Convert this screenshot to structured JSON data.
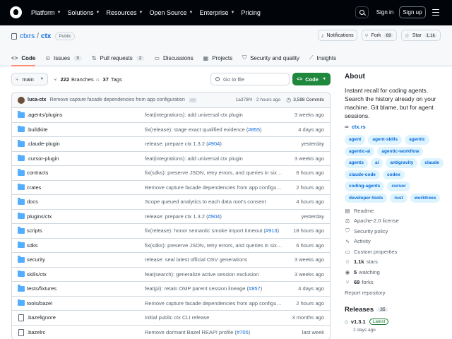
{
  "header": {
    "nav": [
      "Platform",
      "Solutions",
      "Resources",
      "Open Source",
      "Enterprise",
      "Pricing"
    ],
    "nav_has_chevron": [
      true,
      true,
      true,
      true,
      true,
      false
    ],
    "signin": "Sign in",
    "signup": "Sign up"
  },
  "repo": {
    "owner": "ctxrs",
    "sep": "/",
    "name": "ctx",
    "visibility": "Public",
    "notifications": "Notifications",
    "fork_label": "Fork",
    "fork_count": "69",
    "star_label": "Star",
    "star_count": "1.1k"
  },
  "tabs": [
    {
      "label": "Code",
      "icon": "<>",
      "count": ""
    },
    {
      "label": "Issues",
      "icon": "⊙",
      "count": "3"
    },
    {
      "label": "Pull requests",
      "icon": "⇅",
      "count": "2"
    },
    {
      "label": "Discussions",
      "icon": "▭",
      "count": ""
    },
    {
      "label": "Projects",
      "icon": "▦",
      "count": ""
    },
    {
      "label": "Security and quality",
      "icon": "⛉",
      "count": ""
    },
    {
      "label": "Insights",
      "icon": "⟋",
      "count": ""
    }
  ],
  "toolbar": {
    "branch": "main",
    "branches_count": "222",
    "branches_label": "Branches",
    "tags_count": "37",
    "tags_label": "Tags",
    "gofile_placeholder": "Go to file",
    "code_label": "Code"
  },
  "commit": {
    "author": "luca-ctx",
    "message": "Remove capture facade dependencies from app configuration",
    "dots": "···",
    "hash_time": "1a378f4 · 2 hours ago",
    "commits": "3,598 Commits"
  },
  "files": [
    {
      "type": "folder",
      "name": ".agents/plugins",
      "msg": "feat(integrations): add universal ctx plugin",
      "pr": "",
      "time": "3 weeks ago"
    },
    {
      "type": "folder",
      "name": ".buildkite",
      "msg": "fix(release): stage exact qualified evidence (",
      "pr": "#855",
      "suffix": ")",
      "time": "4 days ago"
    },
    {
      "type": "folder",
      "name": ".claude-plugin",
      "msg": "release: prepare ctx 1.3.2 (",
      "pr": "#904",
      "suffix": ")",
      "time": "yesterday"
    },
    {
      "type": "folder",
      "name": ".cursor-plugin",
      "msg": "feat(integrations): add universal ctx plugin",
      "pr": "",
      "time": "3 weeks ago"
    },
    {
      "type": "folder",
      "name": "contracts",
      "msg": "fix(sdks): preserve JSON, retry errors, and queries in six lan…",
      "pr": "",
      "time": "6 hours ago"
    },
    {
      "type": "folder",
      "name": "crates",
      "msg": "Remove capture facade dependencies from app configuration",
      "pr": "",
      "time": "2 hours ago"
    },
    {
      "type": "folder",
      "name": "docs",
      "msg": "Scope queued analytics to each data root's consent",
      "pr": "",
      "time": "4 hours ago"
    },
    {
      "type": "folder",
      "name": "plugins/ctx",
      "msg": "release: prepare ctx 1.3.2 (",
      "pr": "#904",
      "suffix": ")",
      "time": "yesterday"
    },
    {
      "type": "folder",
      "name": "scripts",
      "msg": "fix(release): honor semantic smoke import timeout (",
      "pr": "#913",
      "suffix": ")",
      "time": "18 hours ago"
    },
    {
      "type": "folder",
      "name": "sdks",
      "msg": "fix(sdks): preserve JSON, retry errors, and queries in six lan…",
      "pr": "",
      "time": "6 hours ago"
    },
    {
      "type": "folder",
      "name": "security",
      "msg": "release: seal latest official OSV generations",
      "pr": "",
      "time": "3 weeks ago"
    },
    {
      "type": "folder",
      "name": "skills/ctx",
      "msg": "feat(search): generalize active session exclusion",
      "pr": "",
      "time": "3 weeks ago"
    },
    {
      "type": "folder",
      "name": "tests/fixtures",
      "msg": "feat(pi): retain OMP parent session lineage (",
      "pr": "#857",
      "suffix": ")",
      "time": "4 days ago"
    },
    {
      "type": "folder",
      "name": "tools/bazel",
      "msg": "Remove capture facade dependencies from app configuration",
      "pr": "",
      "time": "2 hours ago"
    },
    {
      "type": "file",
      "name": ".bazelignore",
      "msg": "Initial public ctx CLI release",
      "pr": "",
      "time": "3 months ago"
    },
    {
      "type": "file",
      "name": ".bazelrc",
      "msg": "Remove dormant Bazel REAPI profile (",
      "pr": "#705",
      "suffix": ")",
      "time": "last week"
    }
  ],
  "about": {
    "heading": "About",
    "description": "Instant recall for coding agents. Search the history already on your machine. Git blame, but for agent sessions.",
    "website": "ctx.rs",
    "topics": [
      "agent",
      "agent-skills",
      "agentic",
      "agentic-ai",
      "agentic-workflow",
      "agents",
      "ai",
      "antigravity",
      "claude",
      "claude-code",
      "codex",
      "coding-agents",
      "cursor",
      "developer-tools",
      "rust",
      "worktrees"
    ],
    "meta": [
      {
        "icon": "book-icon",
        "glyph": "▤",
        "bold": "",
        "text": "Readme"
      },
      {
        "icon": "law-icon",
        "glyph": "⚖",
        "bold": "",
        "text": "Apache-2.0 license"
      },
      {
        "icon": "shield-icon",
        "glyph": "⛉",
        "bold": "",
        "text": "Security policy"
      },
      {
        "icon": "pulse-icon",
        "glyph": "∿",
        "bold": "",
        "text": "Activity"
      },
      {
        "icon": "note-icon",
        "glyph": "▭",
        "bold": "",
        "text": "Custom properties"
      },
      {
        "icon": "star-icon",
        "glyph": "☆",
        "bold": "1.1k",
        "text": "stars"
      },
      {
        "icon": "eye-icon",
        "glyph": "◉",
        "bold": "5",
        "text": "watching"
      },
      {
        "icon": "fork-icon",
        "glyph": "⑂",
        "bold": "69",
        "text": "forks"
      }
    ],
    "report": "Report repository"
  },
  "releases": {
    "heading": "Releases",
    "count": "35",
    "tag": "v1.3.1",
    "latest": "Latest",
    "date": "2 days ago"
  }
}
